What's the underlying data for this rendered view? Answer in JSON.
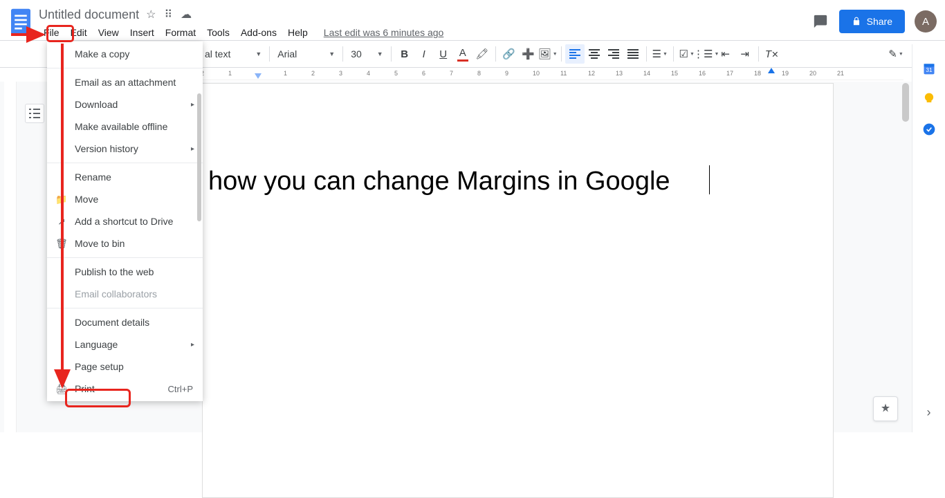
{
  "doc": {
    "title": "Untitled document",
    "last_edit": "Last edit was 6 minutes ago"
  },
  "menubar": [
    "File",
    "Edit",
    "View",
    "Insert",
    "Format",
    "Tools",
    "Add-ons",
    "Help"
  ],
  "share": {
    "label": "Share"
  },
  "avatar": {
    "initial": "A"
  },
  "toolbar": {
    "style_dd": "al text",
    "font_dd": "Arial",
    "size": "30"
  },
  "file_menu": [
    {
      "label": "Make a copy"
    },
    {
      "sep": true
    },
    {
      "label": "Email as an attachment"
    },
    {
      "label": "Download",
      "submenu": true
    },
    {
      "label": "Make available offline"
    },
    {
      "label": "Version history",
      "submenu": true
    },
    {
      "sep": true
    },
    {
      "label": "Rename"
    },
    {
      "label": "Move",
      "icon": "folder"
    },
    {
      "label": "Add a shortcut to Drive",
      "icon": "shortcut"
    },
    {
      "label": "Move to bin",
      "icon": "trash"
    },
    {
      "sep": true
    },
    {
      "label": "Publish to the web"
    },
    {
      "label": "Email collaborators",
      "disabled": true
    },
    {
      "sep": true
    },
    {
      "label": "Document details"
    },
    {
      "label": "Language",
      "submenu": true
    },
    {
      "label": "Page setup"
    },
    {
      "label": "Print",
      "icon": "print",
      "shortcut": "Ctrl+P"
    }
  ],
  "page_text": "how you can change Margins in Google",
  "ruler_numbers": [
    2,
    1,
    "",
    1,
    2,
    3,
    4,
    5,
    6,
    7,
    8,
    9,
    10,
    11,
    12,
    13,
    14,
    15,
    16,
    17,
    18,
    19,
    20,
    21
  ]
}
